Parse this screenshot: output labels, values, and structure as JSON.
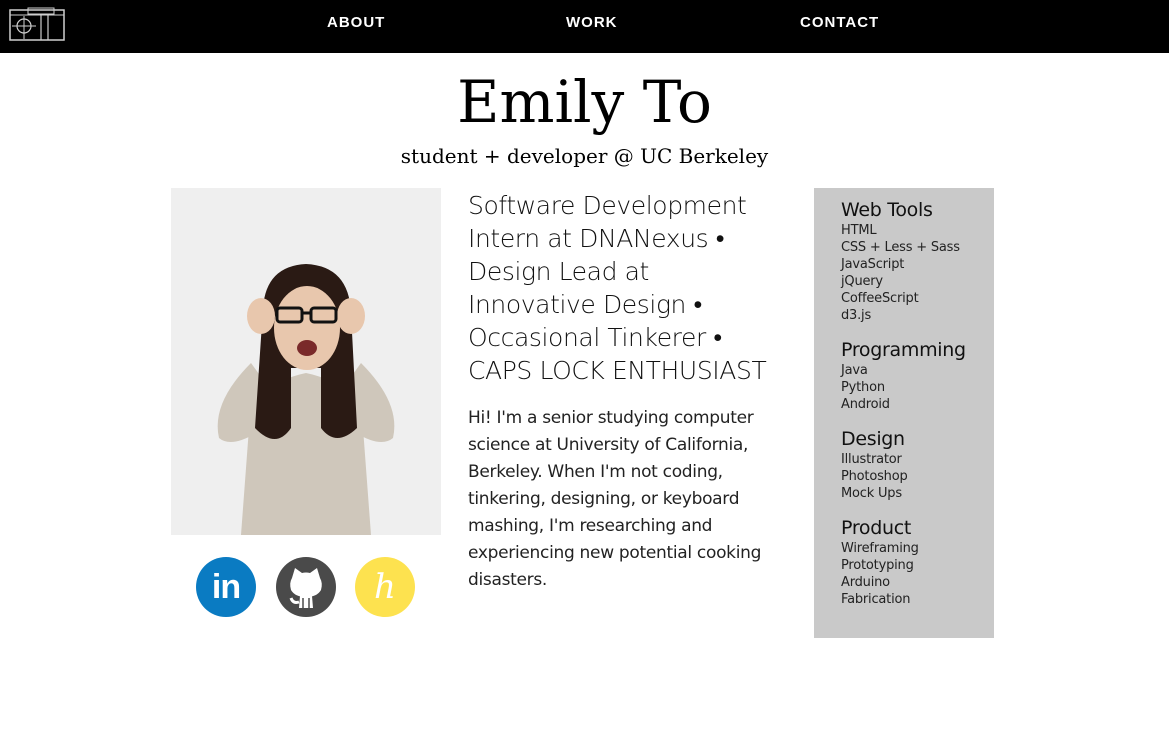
{
  "nav": {
    "items": [
      {
        "label": "ABOUT"
      },
      {
        "label": "WORK"
      },
      {
        "label": "CONTACT"
      }
    ]
  },
  "header": {
    "name": "Emily To",
    "subtitle": "student + developer @ UC Berkeley"
  },
  "profile": {
    "tagline": "Software Development Intern at DNANexus • Design Lead at Innovative Design • Occasional Tinkerer • CAPS LOCK ENTHUSIAST",
    "bio": "Hi! I'm a senior studying computer science at University of California, Berkeley. When I'm not coding, tinkering, designing, or keyboard mashing, I'm researching and experiencing new potential cooking disasters."
  },
  "social": {
    "linkedin_text": "in",
    "hackerrank_text": "h",
    "colors": {
      "linkedin": "#0a7bc2",
      "github": "#4a4a4a",
      "hackerrank": "#fde24f"
    }
  },
  "skills": {
    "groups": [
      {
        "title": "Web Tools",
        "items": [
          "HTML",
          "CSS + Less + Sass",
          "JavaScript",
          "jQuery",
          "CoffeeScript",
          "d3.js"
        ]
      },
      {
        "title": "Programming",
        "items": [
          "Java",
          "Python",
          "Android"
        ]
      },
      {
        "title": "Design",
        "items": [
          "Illustrator",
          "Photoshop",
          "Mock Ups"
        ]
      },
      {
        "title": "Product",
        "items": [
          "Wireframing",
          "Prototyping",
          "Arduino",
          "Fabrication"
        ]
      }
    ]
  }
}
